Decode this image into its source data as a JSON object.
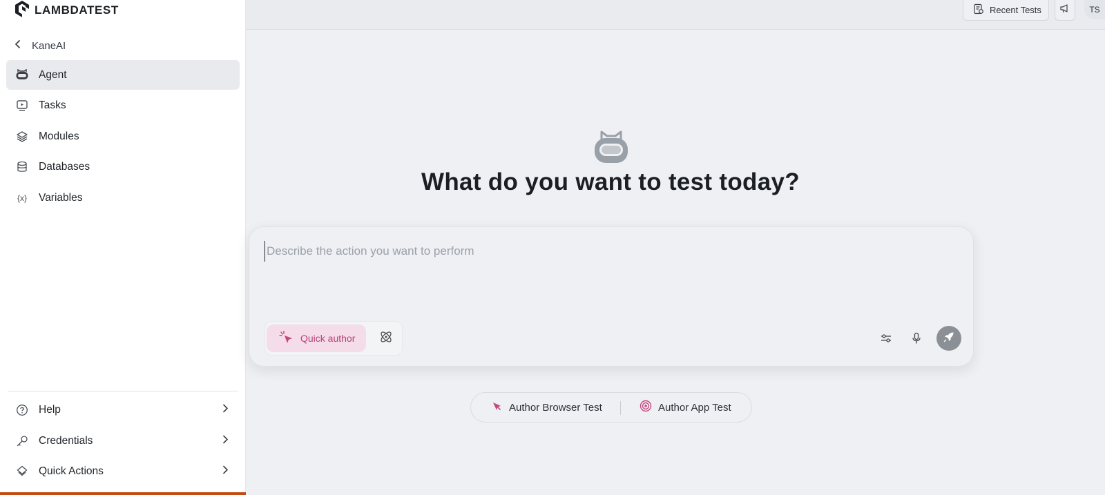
{
  "brand": {
    "name": "LAMBDATEST"
  },
  "sidebar": {
    "back_label": "KaneAI",
    "items": [
      {
        "label": "Agent",
        "icon": "agent-icon",
        "active": true
      },
      {
        "label": "Tasks",
        "icon": "tasks-icon"
      },
      {
        "label": "Modules",
        "icon": "layers-icon"
      },
      {
        "label": "Databases",
        "icon": "database-icon"
      },
      {
        "label": "Variables",
        "icon": "variables-icon",
        "glyph": "{x}"
      }
    ],
    "bottom_items": [
      {
        "label": "Help",
        "icon": "help-icon"
      },
      {
        "label": "Credentials",
        "icon": "key-icon"
      },
      {
        "label": "Quick Actions",
        "icon": "quick-actions-icon"
      }
    ]
  },
  "topbar": {
    "recent_tests_label": "Recent Tests",
    "avatar_initials": "TS"
  },
  "main": {
    "title": "What do you want to test today?",
    "prompt_placeholder": "Describe the action you want to perform",
    "quick_author_label": "Quick author",
    "author_browser_label": "Author Browser Test",
    "author_app_label": "Author App Test"
  },
  "colors": {
    "accent_pink": "#b8407a",
    "quick_author_bg": "#f4dde8",
    "bottom_bar": "#c24c14",
    "send_button": "#8b9096"
  }
}
